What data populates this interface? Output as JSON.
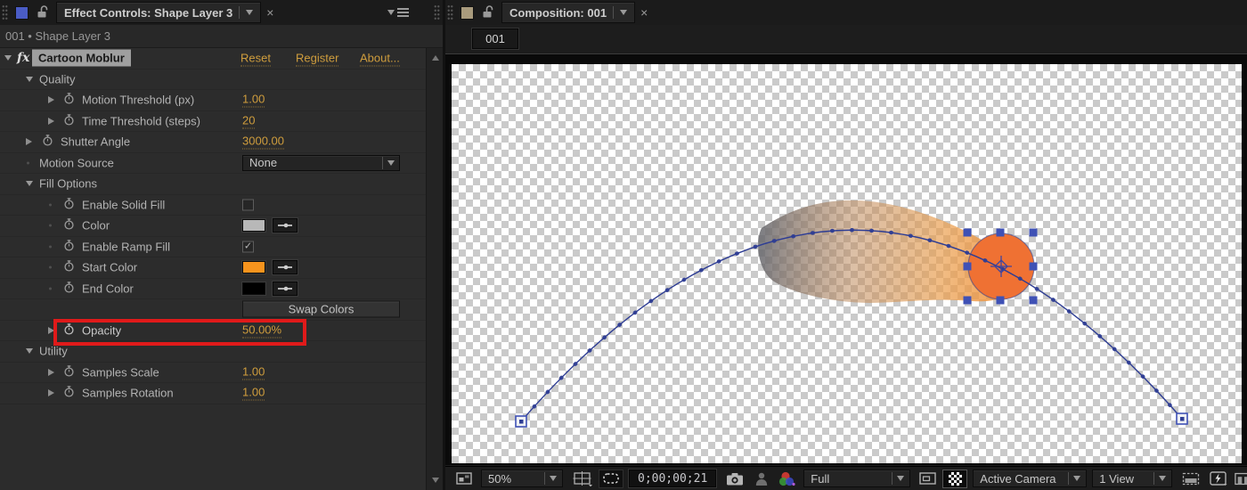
{
  "colors": {
    "accent_value": "#cf9d3d",
    "annotation_red": "#e01a1a",
    "layer_swatch_blue": "#4a5cc5",
    "comp_swatch_tan": "#a99b7d",
    "swatch_solid_gray": "#b8b8b8",
    "swatch_start_orange": "#f7941d",
    "swatch_end_black": "#000000",
    "shape_fill": "#ef7133",
    "path_navy": "#2e3d94",
    "handle_blue": "#3f51b5",
    "checker_dark": "#cacaca",
    "checker_light": "#ffffff"
  },
  "effects_panel": {
    "tab_title": "Effect Controls: Shape Layer 3",
    "close_label": "×",
    "breadcrumb": "001 • Shape Layer 3",
    "fx_badge": "fx",
    "effect_name": "Cartoon Moblur",
    "links": {
      "reset": "Reset",
      "register": "Register",
      "about": "About..."
    },
    "groups": {
      "quality": "Quality",
      "fill": "Fill Options",
      "utility": "Utility"
    },
    "params": {
      "motion_threshold": {
        "label": "Motion Threshold (px)",
        "value": "1.00"
      },
      "time_threshold": {
        "label": "Time Threshold (steps)",
        "value": "20"
      },
      "shutter_angle": {
        "label": "Shutter Angle",
        "value": "3000.00"
      },
      "motion_source": {
        "label": "Motion Source",
        "value": "None"
      },
      "enable_solid_fill": {
        "label": "Enable Solid Fill"
      },
      "color": {
        "label": "Color"
      },
      "enable_ramp_fill": {
        "label": "Enable Ramp Fill",
        "checkmark": "✓"
      },
      "start_color": {
        "label": "Start Color"
      },
      "end_color": {
        "label": "End Color"
      },
      "swap_colors": {
        "label": "Swap Colors"
      },
      "opacity": {
        "label": "Opacity",
        "value": "50.00%"
      },
      "samples_scale": {
        "label": "Samples Scale",
        "value": "1.00"
      },
      "samples_rotation": {
        "label": "Samples Rotation",
        "value": "1.00"
      }
    }
  },
  "comp_panel": {
    "tab_title": "Composition: 001",
    "close_label": "×",
    "comp_button": "001",
    "toolbar": {
      "zoom": "50%",
      "timecode": "0;00;00;21",
      "resolution": "Full",
      "camera": "Active Camera",
      "view_layout": "1 View"
    }
  }
}
